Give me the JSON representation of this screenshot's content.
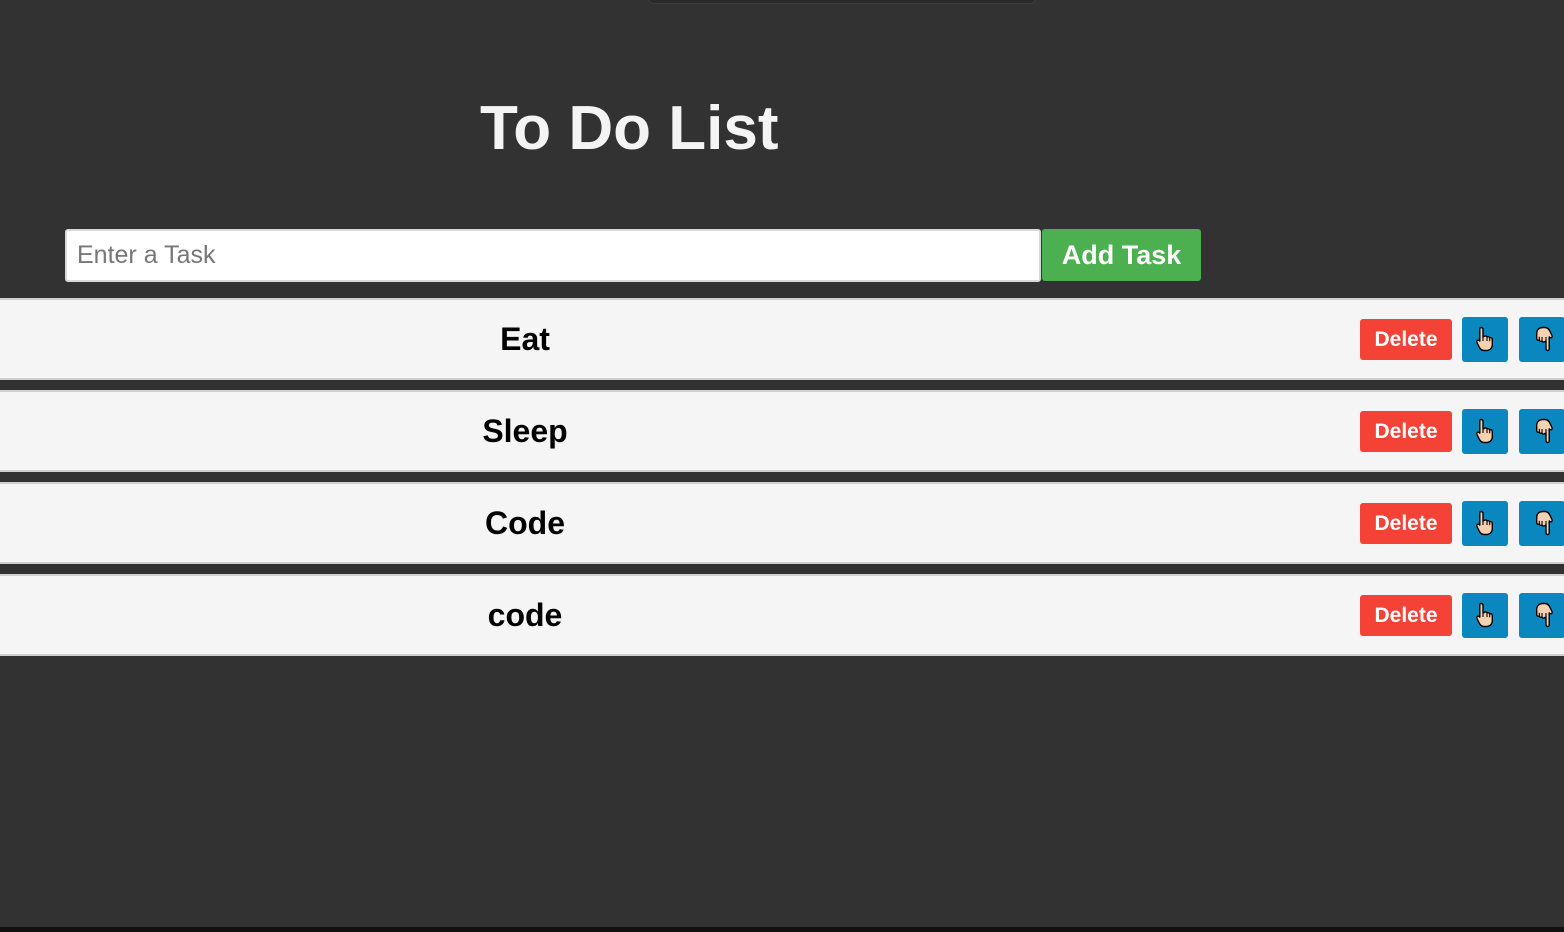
{
  "title": "To Do List",
  "input": {
    "placeholder": "Enter a Task",
    "value": ""
  },
  "add_button_label": "Add Task",
  "tasks": [
    {
      "text": "Eat",
      "delete_label": "Delete"
    },
    {
      "text": "Sleep",
      "delete_label": "Delete"
    },
    {
      "text": "Code",
      "delete_label": "Delete"
    },
    {
      "text": "code",
      "delete_label": "Delete"
    }
  ],
  "icons": {
    "move_up": "pointing-up-hand-icon",
    "move_down": "pointing-down-hand-icon"
  },
  "colors": {
    "background": "#323232",
    "add_button": "#4caf50",
    "delete_button": "#f44336",
    "move_button": "#0b87bf",
    "row_background": "#f5f5f5"
  }
}
